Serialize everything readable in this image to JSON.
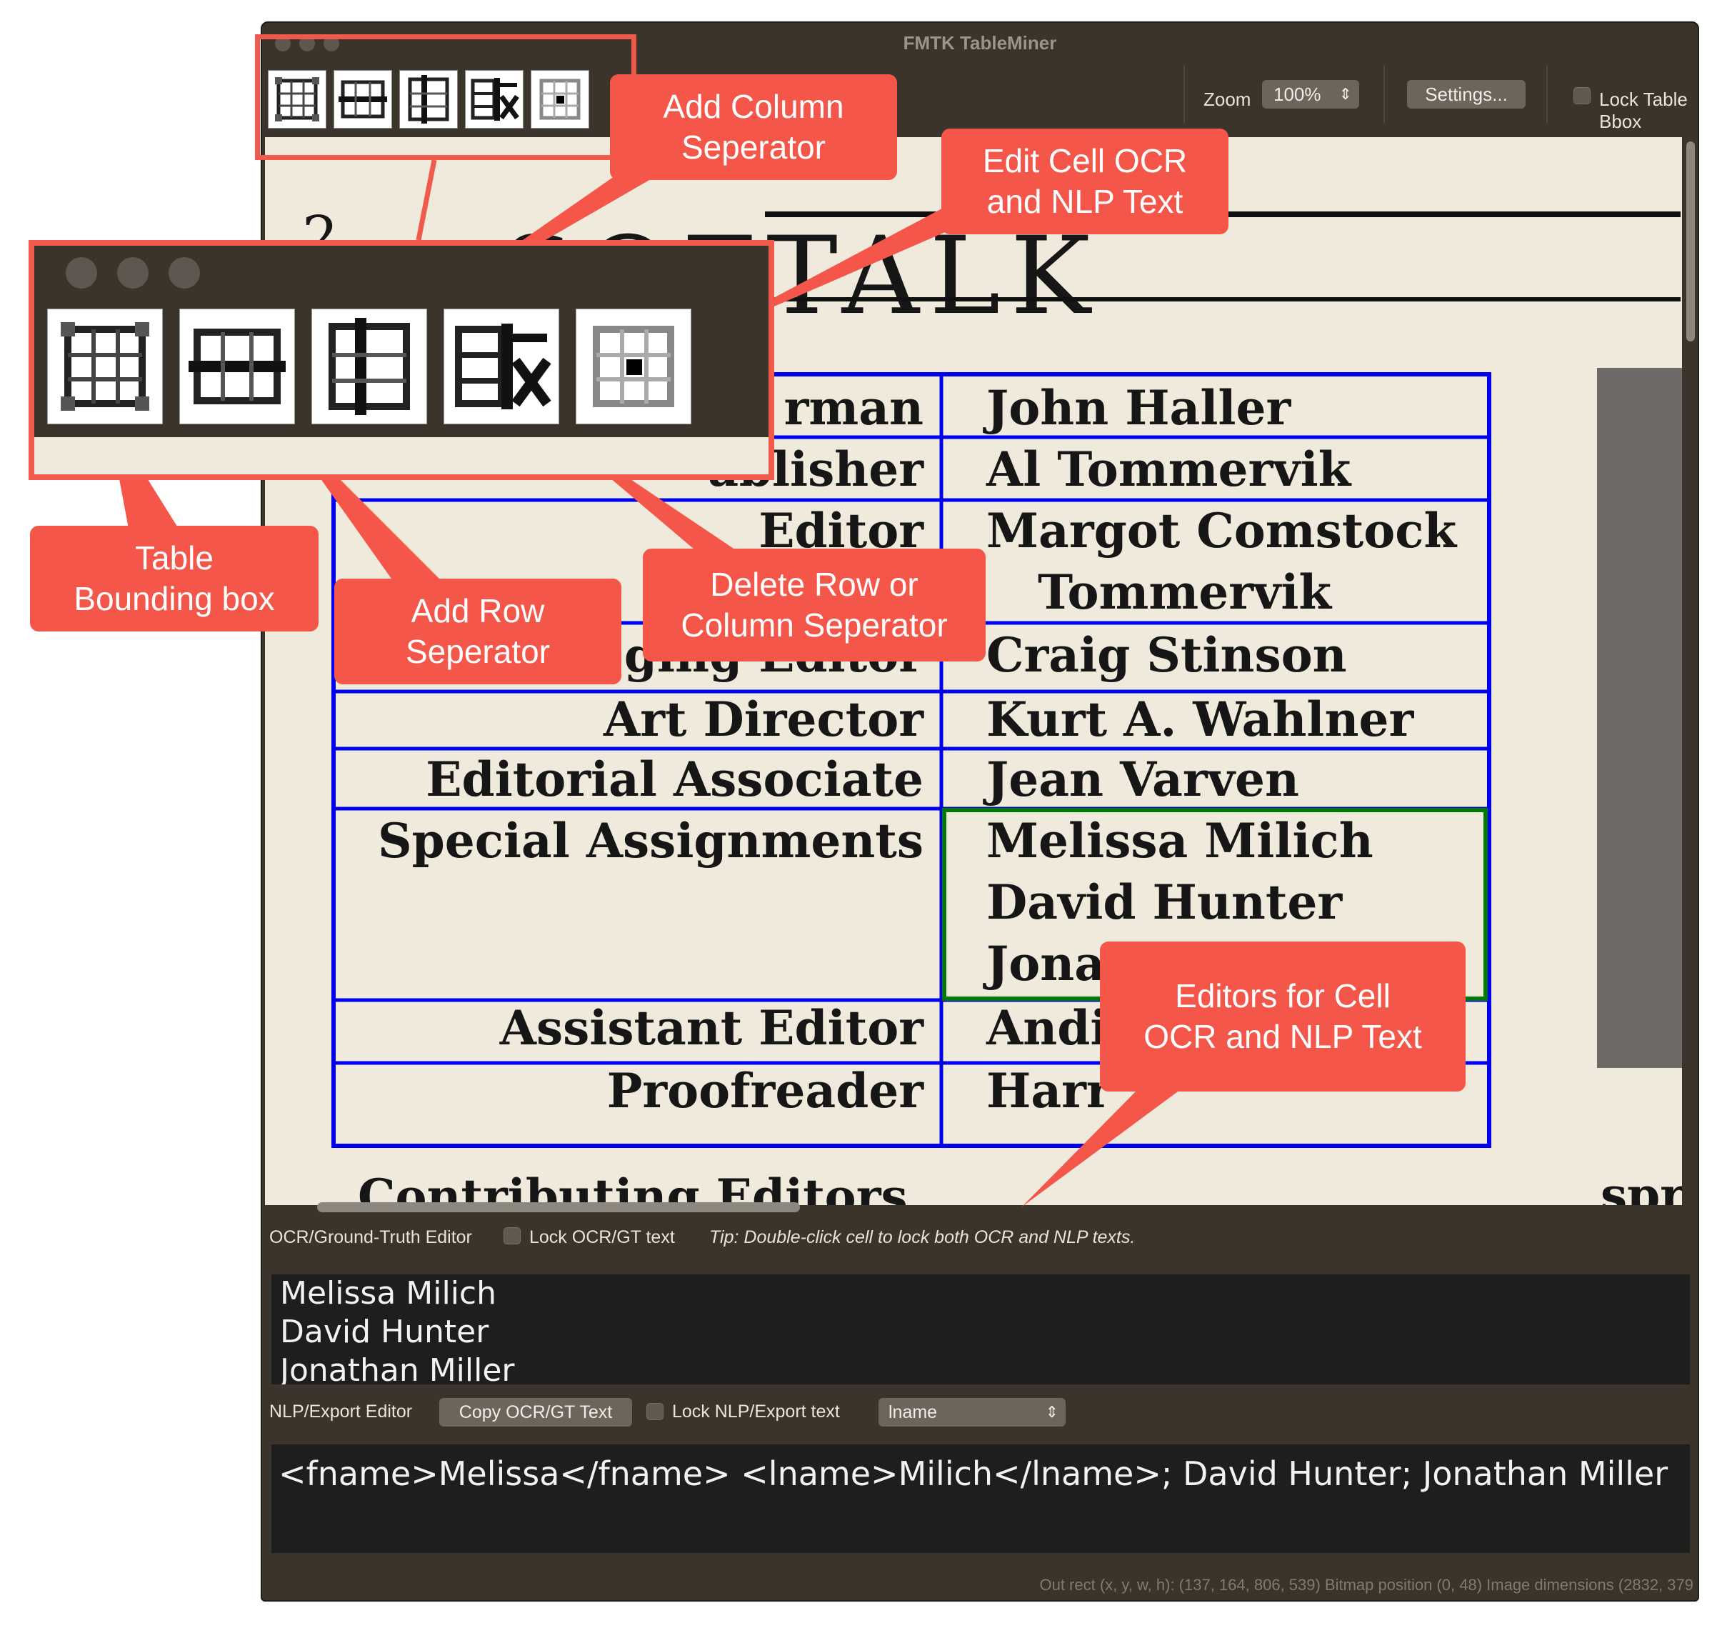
{
  "window": {
    "title": "FMTK TableMiner"
  },
  "toolbar": {
    "zoom_label": "Zoom",
    "zoom_value": "100%",
    "settings_label": "Settings...",
    "lock_table_bbox_label": "Lock Table Bbox",
    "tools": [
      {
        "name": "table-bounding-box-tool",
        "icon": "table-bbox-icon"
      },
      {
        "name": "add-row-separator-tool",
        "icon": "add-row-separator-icon"
      },
      {
        "name": "add-column-separator-tool",
        "icon": "add-column-separator-icon"
      },
      {
        "name": "delete-separator-tool",
        "icon": "delete-separator-icon"
      },
      {
        "name": "edit-cell-text-tool",
        "icon": "edit-cell-icon"
      }
    ]
  },
  "scan": {
    "page_number": "2",
    "masthead": "SOFTALK",
    "rows": [
      {
        "role": "rman",
        "name": "John Haller"
      },
      {
        "role": "ublisher",
        "name": "Al Tommervik"
      },
      {
        "role": "Editor",
        "name": "Margot Comstock"
      },
      {
        "role": "",
        "name": "Tommervik"
      },
      {
        "role": "ging Editor",
        "name": "Craig Stinson"
      },
      {
        "role": "Art Director",
        "name": "Kurt A. Wahlner"
      },
      {
        "role": "Editorial Associate",
        "name": "Jean Varven"
      },
      {
        "role": "Special Assignments",
        "name": "Melissa Milich"
      },
      {
        "role": "",
        "name": "David Hunter"
      },
      {
        "role": "",
        "name": "Jona"
      },
      {
        "role": "Assistant Editor",
        "name": "Andi"
      },
      {
        "role": "Proofreader",
        "name": "Harr"
      }
    ],
    "footer_partial": "Contributing Editors",
    "footer_right_partial": "spr",
    "colors": {
      "table_lines": "#0000ee",
      "selected_cell": "#007a00"
    }
  },
  "ocr_editor": {
    "label": "OCR/Ground-Truth Editor",
    "lock_label": "Lock OCR/GT text",
    "tip": "Tip: Double-click cell to lock both OCR and NLP texts.",
    "lines": [
      "Melissa Milich",
      "David Hunter",
      "Jonathan Miller"
    ]
  },
  "nlp_editor": {
    "label": "NLP/Export Editor",
    "copy_button": "Copy OCR/GT Text",
    "lock_label": "Lock NLP/Export text",
    "tag_select": "lname",
    "text": "<fname>Melissa</fname> <lname>Milich</lname>; David Hunter; Jonathan Miller"
  },
  "statusbar": {
    "text": "Out rect (x, y, w, h): (137, 164, 806, 539) Bitmap position (0, 48) Image dimensions (2832, 379"
  },
  "callouts": {
    "add_column": "Add Column\nSeperator",
    "edit_cell": "Edit Cell OCR\nand NLP Text",
    "table_bbox": "Table\nBounding box",
    "add_row": "Add Row\nSeperator",
    "delete_sep": "Delete Row or\nColumn Seperator",
    "editors": "Editors for Cell\nOCR and NLP Text"
  },
  "accent_colors": {
    "callout": "#f4574a",
    "window_bg": "#3a342b"
  }
}
